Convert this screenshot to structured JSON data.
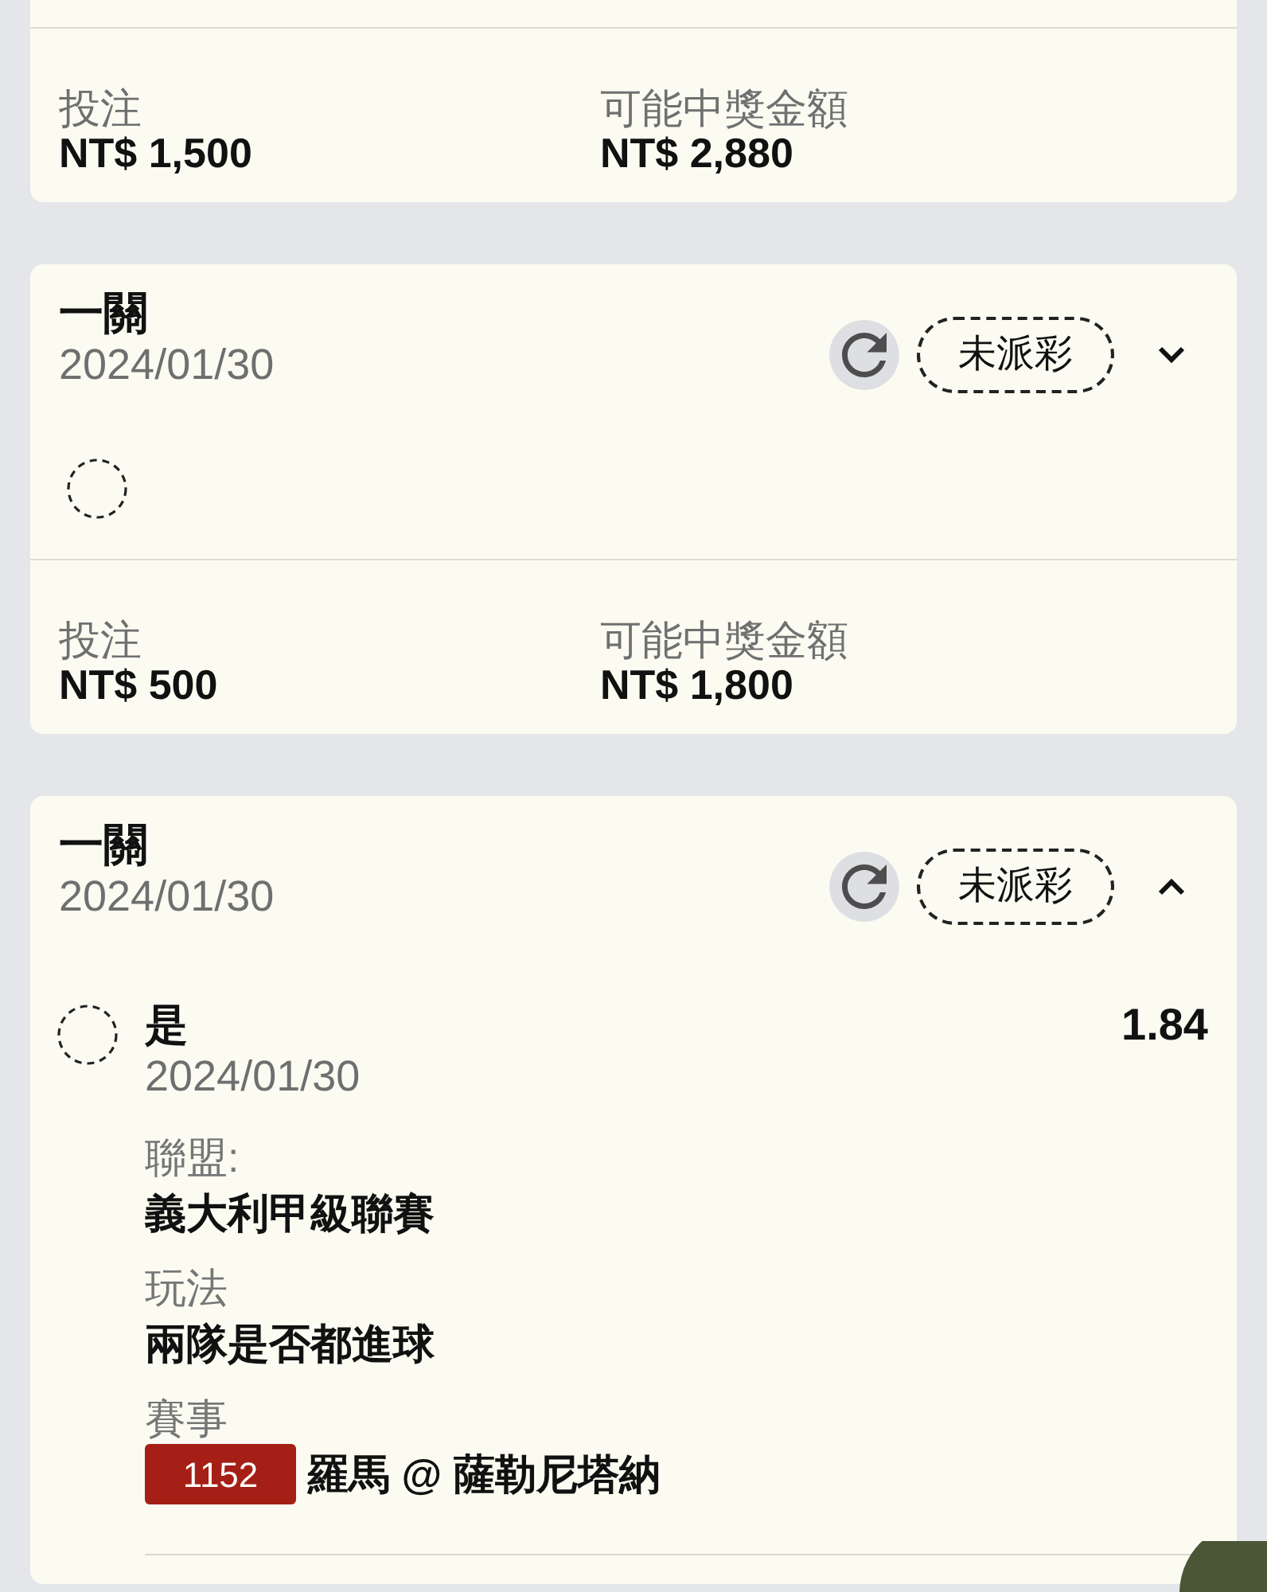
{
  "bets": [
    {
      "stake_label": "投注",
      "stake": "NT$ 1,500",
      "payout_label": "可能中獎金額",
      "payout": "NT$ 2,880"
    },
    {
      "title": "一關",
      "date": "2024/01/30",
      "status": "未派彩",
      "expanded": false,
      "selections": [
        {
          "settled": false
        }
      ],
      "stake_label": "投注",
      "stake": "NT$ 500",
      "payout_label": "可能中獎金額",
      "payout": "NT$ 1,800"
    },
    {
      "title": "一關",
      "date": "2024/01/30",
      "status": "未派彩",
      "expanded": true,
      "selections": [
        {
          "settled": false,
          "pick": "是",
          "date": "2024/01/30",
          "odds": "1.84",
          "details": [
            {
              "label": "聯盟:",
              "value": "義大利甲級聯賽"
            },
            {
              "label": "玩法",
              "value": "兩隊是否都進球"
            },
            {
              "label": "賽事",
              "badge": "1152",
              "value": "羅馬 @ 薩勒尼塔納"
            }
          ]
        }
      ]
    }
  ]
}
